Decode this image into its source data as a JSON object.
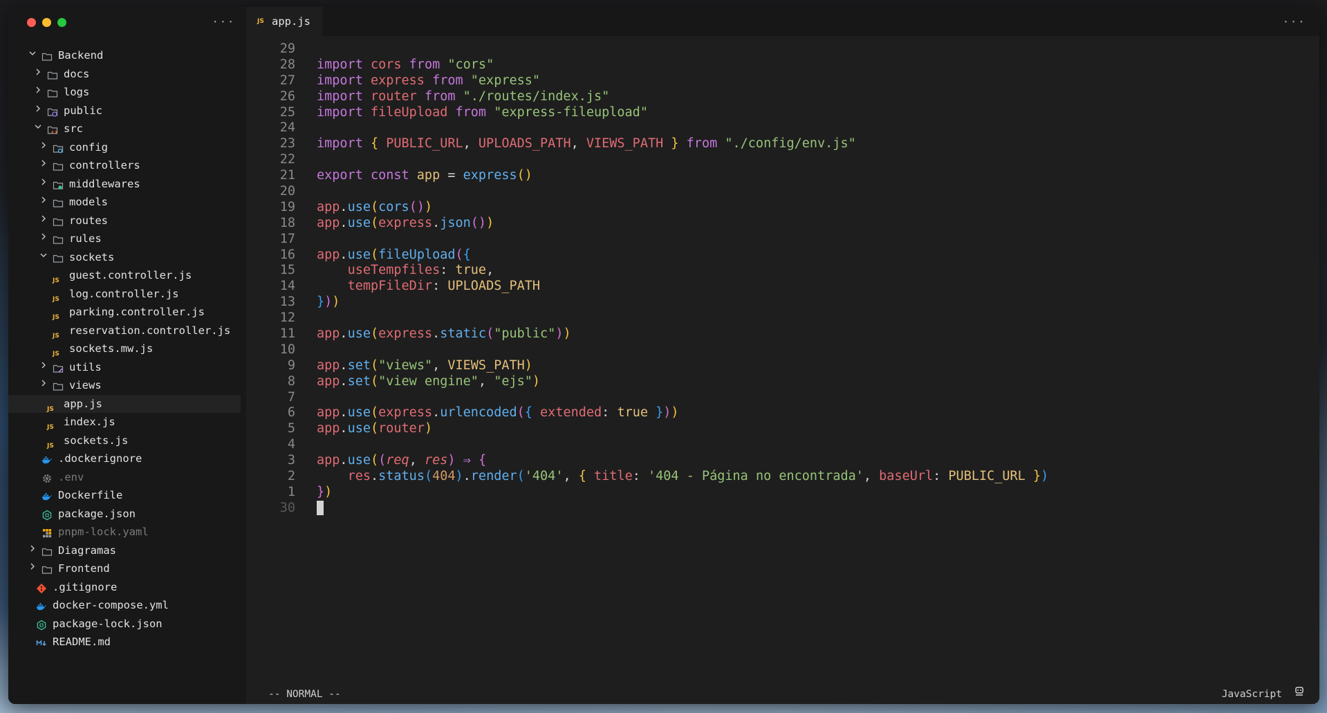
{
  "sidebar": {
    "menu_glyph": "···",
    "items": [
      {
        "label": "Backend",
        "depth": 0,
        "kind": "folder",
        "chevron": "down"
      },
      {
        "label": "docs",
        "depth": 1,
        "kind": "folder",
        "chevron": "right"
      },
      {
        "label": "logs",
        "depth": 1,
        "kind": "folder",
        "chevron": "right"
      },
      {
        "label": "public",
        "depth": 1,
        "kind": "folder-public",
        "chevron": "right"
      },
      {
        "label": "src",
        "depth": 1,
        "kind": "folder-src",
        "chevron": "down"
      },
      {
        "label": "config",
        "depth": 2,
        "kind": "folder-config",
        "chevron": "right"
      },
      {
        "label": "controllers",
        "depth": 2,
        "kind": "folder",
        "chevron": "right"
      },
      {
        "label": "middlewares",
        "depth": 2,
        "kind": "folder-mw",
        "chevron": "right"
      },
      {
        "label": "models",
        "depth": 2,
        "kind": "folder",
        "chevron": "right"
      },
      {
        "label": "routes",
        "depth": 2,
        "kind": "folder",
        "chevron": "right"
      },
      {
        "label": "rules",
        "depth": 2,
        "kind": "folder",
        "chevron": "right"
      },
      {
        "label": "sockets",
        "depth": 2,
        "kind": "folder",
        "chevron": "down"
      },
      {
        "label": "guest.controller.js",
        "depth": 3,
        "kind": "js"
      },
      {
        "label": "log.controller.js",
        "depth": 3,
        "kind": "js"
      },
      {
        "label": "parking.controller.js",
        "depth": 3,
        "kind": "js"
      },
      {
        "label": "reservation.controller.js",
        "depth": 3,
        "kind": "js"
      },
      {
        "label": "sockets.mw.js",
        "depth": 3,
        "kind": "js"
      },
      {
        "label": "utils",
        "depth": 2,
        "kind": "folder-utils",
        "chevron": "right"
      },
      {
        "label": "views",
        "depth": 2,
        "kind": "folder",
        "chevron": "right"
      },
      {
        "label": "app.js",
        "depth": 2,
        "kind": "js",
        "selected": true
      },
      {
        "label": "index.js",
        "depth": 2,
        "kind": "js"
      },
      {
        "label": "sockets.js",
        "depth": 2,
        "kind": "js"
      },
      {
        "label": ".dockerignore",
        "depth": 1,
        "kind": "docker"
      },
      {
        "label": ".env",
        "depth": 1,
        "kind": "gear",
        "dim": true
      },
      {
        "label": "Dockerfile",
        "depth": 1,
        "kind": "docker"
      },
      {
        "label": "package.json",
        "depth": 1,
        "kind": "npm"
      },
      {
        "label": "pnpm-lock.yaml",
        "depth": 1,
        "kind": "pnpm",
        "dim": true
      },
      {
        "label": "Diagramas",
        "depth": 0,
        "kind": "folder",
        "chevron": "right"
      },
      {
        "label": "Frontend",
        "depth": 0,
        "kind": "folder",
        "chevron": "right"
      },
      {
        "label": ".gitignore",
        "depth": 0,
        "kind": "git"
      },
      {
        "label": "docker-compose.yml",
        "depth": 0,
        "kind": "docker"
      },
      {
        "label": "package-lock.json",
        "depth": 0,
        "kind": "npm"
      },
      {
        "label": "README.md",
        "depth": 0,
        "kind": "md"
      }
    ]
  },
  "editor": {
    "tab": {
      "icon": "JS",
      "name": "app.js"
    },
    "menu_glyph": "···",
    "lines": [
      {
        "n": "29",
        "t": []
      },
      {
        "n": "28",
        "t": [
          [
            "kw",
            "import "
          ],
          [
            "var",
            "cors "
          ],
          [
            "kw",
            "from "
          ],
          [
            "str",
            "\"cors\""
          ]
        ]
      },
      {
        "n": "27",
        "t": [
          [
            "kw",
            "import "
          ],
          [
            "var",
            "express "
          ],
          [
            "kw",
            "from "
          ],
          [
            "str",
            "\"express\""
          ]
        ]
      },
      {
        "n": "26",
        "t": [
          [
            "kw",
            "import "
          ],
          [
            "var",
            "router "
          ],
          [
            "kw",
            "from "
          ],
          [
            "str",
            "\"./routes/index.js\""
          ]
        ]
      },
      {
        "n": "25",
        "t": [
          [
            "kw",
            "import "
          ],
          [
            "var",
            "fileUpload "
          ],
          [
            "kw",
            "from "
          ],
          [
            "str",
            "\"express-fileupload\""
          ]
        ]
      },
      {
        "n": "24",
        "t": []
      },
      {
        "n": "23",
        "t": [
          [
            "kw",
            "import "
          ],
          [
            "br1",
            "{ "
          ],
          [
            "var",
            "PUBLIC_URL"
          ],
          [
            "plain",
            ", "
          ],
          [
            "var",
            "UPLOADS_PATH"
          ],
          [
            "plain",
            ", "
          ],
          [
            "var",
            "VIEWS_PATH"
          ],
          [
            "br1",
            " } "
          ],
          [
            "kw",
            "from "
          ],
          [
            "str",
            "\"./config/env.js\""
          ]
        ]
      },
      {
        "n": "22",
        "t": []
      },
      {
        "n": "21",
        "t": [
          [
            "kw",
            "export "
          ],
          [
            "kw",
            "const "
          ],
          [
            "cst",
            "app "
          ],
          [
            "plain",
            "= "
          ],
          [
            "fn",
            "express"
          ],
          [
            "br1",
            "()"
          ]
        ]
      },
      {
        "n": "20",
        "t": []
      },
      {
        "n": "19",
        "t": [
          [
            "var",
            "app"
          ],
          [
            "plain",
            "."
          ],
          [
            "fn",
            "use"
          ],
          [
            "br1",
            "("
          ],
          [
            "fn",
            "cors"
          ],
          [
            "br2",
            "()"
          ],
          [
            "br1",
            ")"
          ]
        ]
      },
      {
        "n": "18",
        "t": [
          [
            "var",
            "app"
          ],
          [
            "plain",
            "."
          ],
          [
            "fn",
            "use"
          ],
          [
            "br1",
            "("
          ],
          [
            "var",
            "express"
          ],
          [
            "plain",
            "."
          ],
          [
            "fn",
            "json"
          ],
          [
            "br2",
            "()"
          ],
          [
            "br1",
            ")"
          ]
        ]
      },
      {
        "n": "17",
        "t": []
      },
      {
        "n": "16",
        "t": [
          [
            "var",
            "app"
          ],
          [
            "plain",
            "."
          ],
          [
            "fn",
            "use"
          ],
          [
            "br1",
            "("
          ],
          [
            "fn",
            "fileUpload"
          ],
          [
            "br2",
            "("
          ],
          [
            "br3",
            "{"
          ]
        ]
      },
      {
        "n": "15",
        "t": [
          [
            "plain",
            "    "
          ],
          [
            "prop",
            "useTempfiles"
          ],
          [
            "plain",
            ": "
          ],
          [
            "cst",
            "true"
          ],
          [
            "plain",
            ","
          ]
        ]
      },
      {
        "n": "14",
        "t": [
          [
            "plain",
            "    "
          ],
          [
            "prop",
            "tempFileDir"
          ],
          [
            "plain",
            ": "
          ],
          [
            "cst",
            "UPLOADS_PATH"
          ]
        ]
      },
      {
        "n": "13",
        "t": [
          [
            "br3",
            "}"
          ],
          [
            "br2",
            ")"
          ],
          [
            "br1",
            ")"
          ]
        ]
      },
      {
        "n": "12",
        "t": []
      },
      {
        "n": "11",
        "t": [
          [
            "var",
            "app"
          ],
          [
            "plain",
            "."
          ],
          [
            "fn",
            "use"
          ],
          [
            "br1",
            "("
          ],
          [
            "var",
            "express"
          ],
          [
            "plain",
            "."
          ],
          [
            "fn",
            "static"
          ],
          [
            "br2",
            "("
          ],
          [
            "str",
            "\"public\""
          ],
          [
            "br2",
            ")"
          ],
          [
            "br1",
            ")"
          ]
        ]
      },
      {
        "n": "10",
        "t": []
      },
      {
        "n": "9",
        "t": [
          [
            "var",
            "app"
          ],
          [
            "plain",
            "."
          ],
          [
            "fn",
            "set"
          ],
          [
            "br1",
            "("
          ],
          [
            "str",
            "\"views\""
          ],
          [
            "plain",
            ", "
          ],
          [
            "cst",
            "VIEWS_PATH"
          ],
          [
            "br1",
            ")"
          ]
        ]
      },
      {
        "n": "8",
        "t": [
          [
            "var",
            "app"
          ],
          [
            "plain",
            "."
          ],
          [
            "fn",
            "set"
          ],
          [
            "br1",
            "("
          ],
          [
            "str",
            "\"view engine\""
          ],
          [
            "plain",
            ", "
          ],
          [
            "str",
            "\"ejs\""
          ],
          [
            "br1",
            ")"
          ]
        ]
      },
      {
        "n": "7",
        "t": []
      },
      {
        "n": "6",
        "t": [
          [
            "var",
            "app"
          ],
          [
            "plain",
            "."
          ],
          [
            "fn",
            "use"
          ],
          [
            "br1",
            "("
          ],
          [
            "var",
            "express"
          ],
          [
            "plain",
            "."
          ],
          [
            "fn",
            "urlencoded"
          ],
          [
            "br2",
            "("
          ],
          [
            "br3",
            "{ "
          ],
          [
            "prop",
            "extended"
          ],
          [
            "plain",
            ": "
          ],
          [
            "cst",
            "true"
          ],
          [
            "br3",
            " }"
          ],
          [
            "br2",
            ")"
          ],
          [
            "br1",
            ")"
          ]
        ]
      },
      {
        "n": "5",
        "t": [
          [
            "var",
            "app"
          ],
          [
            "plain",
            "."
          ],
          [
            "fn",
            "use"
          ],
          [
            "br1",
            "("
          ],
          [
            "var",
            "router"
          ],
          [
            "br1",
            ")"
          ]
        ]
      },
      {
        "n": "4",
        "t": []
      },
      {
        "n": "3",
        "t": [
          [
            "var",
            "app"
          ],
          [
            "plain",
            "."
          ],
          [
            "fn",
            "use"
          ],
          [
            "br1",
            "("
          ],
          [
            "br2",
            "("
          ],
          [
            "par",
            "req"
          ],
          [
            "plain",
            ", "
          ],
          [
            "par",
            "res"
          ],
          [
            "br2",
            ")"
          ],
          [
            "kw",
            " ⇒ "
          ],
          [
            "br2",
            "{"
          ]
        ]
      },
      {
        "n": "2",
        "t": [
          [
            "plain",
            "    "
          ],
          [
            "var",
            "res"
          ],
          [
            "plain",
            "."
          ],
          [
            "fn",
            "status"
          ],
          [
            "br3",
            "("
          ],
          [
            "num",
            "404"
          ],
          [
            "br3",
            ")"
          ],
          [
            "plain",
            "."
          ],
          [
            "fn",
            "render"
          ],
          [
            "br3",
            "("
          ],
          [
            "str",
            "'404'"
          ],
          [
            "plain",
            ", "
          ],
          [
            "br1",
            "{ "
          ],
          [
            "prop",
            "title"
          ],
          [
            "plain",
            ": "
          ],
          [
            "str",
            "'404 - Página no encontrada'"
          ],
          [
            "plain",
            ", "
          ],
          [
            "prop",
            "baseUrl"
          ],
          [
            "plain",
            ": "
          ],
          [
            "cst",
            "PUBLIC_URL"
          ],
          [
            "br1",
            " }"
          ],
          [
            "br3",
            ")"
          ]
        ]
      },
      {
        "n": "1",
        "t": [
          [
            "br2",
            "}"
          ],
          [
            "br1",
            ")"
          ]
        ]
      },
      {
        "n": "30",
        "t": [],
        "current": true
      }
    ]
  },
  "status": {
    "mode": "-- NORMAL --",
    "language": "JavaScript"
  },
  "colors": {
    "accent_js": "#f0b43c",
    "folder": "#9aa0a6"
  }
}
